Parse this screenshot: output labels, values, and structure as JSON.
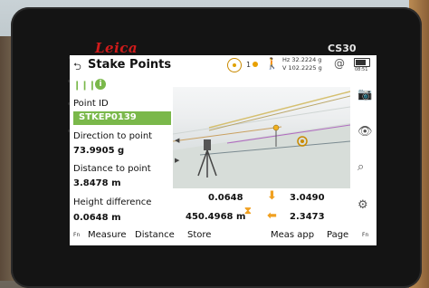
{
  "device": {
    "brand": "Leica",
    "model": "CS30"
  },
  "header": {
    "title": "Stake Points",
    "status_count": "1",
    "hz": "Hz 32.2224 g",
    "v": "V  102.2225 g",
    "clock": "08:51",
    "battery_percent": 80
  },
  "fields": {
    "point_id_label": "Point ID",
    "point_id_value": "STKEP0139",
    "direction_label": "Direction to point",
    "direction_value": "73.9905 g",
    "distance_label": "Distance to point",
    "distance_value": "3.8478 m",
    "height_label": "Height difference",
    "height_value": "0.0648 m"
  },
  "stakeout": {
    "cut_fill": "0.0648",
    "forward": "3.0490",
    "height": "450.4968 m",
    "left": "2.3473"
  },
  "softkeys": {
    "fn_left": "Fn",
    "measure": "Measure",
    "distance": "Distance",
    "store": "Store",
    "meas_app": "Meas app",
    "page": "Page",
    "fn_right": "Fn"
  },
  "icons": {
    "back": "back-icon",
    "compass": "compass-icon",
    "person": "person-icon",
    "at": "at-icon",
    "camera": "camera-icon",
    "eye": "eye-icon",
    "search": "search-icon",
    "settings": "gear-icon"
  },
  "colors": {
    "accent_green": "#7ab84a",
    "arrow_orange": "#f0a020",
    "brand_red": "#d01b1b"
  }
}
